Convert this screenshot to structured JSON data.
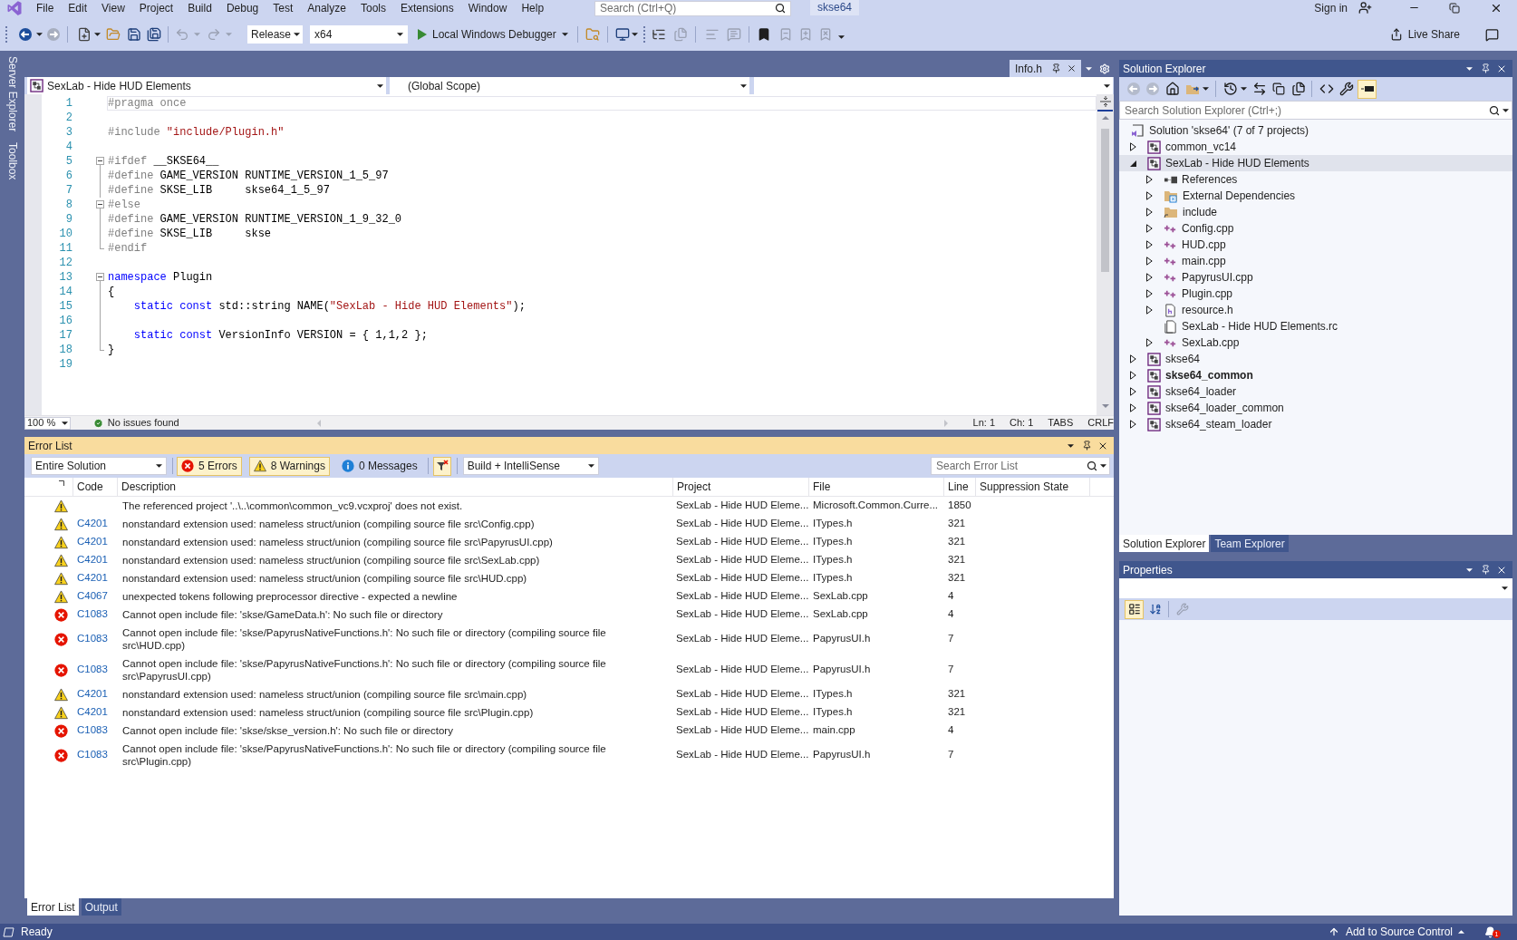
{
  "menu_bar": {
    "items": [
      "File",
      "Edit",
      "View",
      "Project",
      "Build",
      "Debug",
      "Test",
      "Analyze",
      "Tools",
      "Extensions",
      "Window",
      "Help"
    ],
    "search": {
      "placeholder": "Search (Ctrl+Q)"
    },
    "solution_name": "skse64",
    "sign_in": "Sign in"
  },
  "toolbar": {
    "configuration": "Release",
    "platform": "x64",
    "debugger": "Local Windows Debugger",
    "live_share": "Live Share"
  },
  "side_tabs": [
    "Server Explorer",
    "Toolbox"
  ],
  "editor": {
    "tab": {
      "title": "Info.h"
    },
    "navigation": {
      "project": "SexLab - Hide HUD Elements",
      "scope": "(Global Scope)"
    },
    "lines": [
      {
        "number": "1",
        "kind": "plain",
        "current": true,
        "tokens": [
          {
            "kind": "directive",
            "text": "#pragma once"
          }
        ]
      },
      {
        "number": "2",
        "kind": "plain",
        "current": false
      },
      {
        "number": "3",
        "kind": "plain",
        "current": false,
        "tokens": [
          {
            "kind": "directive",
            "text": "#include "
          },
          {
            "kind": "string",
            "text": "\"include/Plugin.h\""
          }
        ]
      },
      {
        "number": "4",
        "kind": "plain",
        "current": false
      },
      {
        "number": "5",
        "kind": "collapsible",
        "current": false,
        "tokens": [
          {
            "kind": "directive",
            "text": "#ifdef "
          },
          {
            "kind": "text",
            "text": "__SKSE64__"
          }
        ]
      },
      {
        "number": "6",
        "kind": "nested",
        "current": false,
        "tokens": [
          {
            "kind": "directive",
            "text": "#define "
          },
          {
            "kind": "text",
            "text": "GAME_VERSION RUNTIME_VERSION_1_5_97"
          }
        ]
      },
      {
        "number": "7",
        "kind": "nested",
        "current": false,
        "tokens": [
          {
            "kind": "directive",
            "text": "#define "
          },
          {
            "kind": "text",
            "text": "SKSE_LIB     skse64_1_5_97"
          }
        ]
      },
      {
        "number": "8",
        "kind": "collapsible",
        "current": false,
        "tokens": [
          {
            "kind": "directive",
            "text": "#else"
          }
        ]
      },
      {
        "number": "9",
        "kind": "nested",
        "current": false,
        "tokens": [
          {
            "kind": "directive",
            "text": "#define "
          },
          {
            "kind": "text",
            "text": "GAME_VERSION RUNTIME_VERSION_1_9_32_0"
          }
        ]
      },
      {
        "number": "10",
        "kind": "nested",
        "current": false,
        "tokens": [
          {
            "kind": "directive",
            "text": "#define "
          },
          {
            "kind": "text",
            "text": "SKSE_LIB     skse"
          }
        ]
      },
      {
        "number": "11",
        "kind": "closing",
        "current": false,
        "tokens": [
          {
            "kind": "directive",
            "text": "#endif"
          }
        ]
      },
      {
        "number": "12",
        "kind": "plain",
        "current": false
      },
      {
        "number": "13",
        "kind": "collapsible",
        "current": false,
        "tokens": [
          {
            "kind": "keyword",
            "text": "namespace "
          },
          {
            "kind": "text",
            "text": "Plugin"
          }
        ]
      },
      {
        "number": "14",
        "kind": "nested",
        "current": false,
        "tokens": [
          {
            "kind": "text",
            "text": "{"
          }
        ]
      },
      {
        "number": "15",
        "kind": "nested",
        "current": false,
        "tokens": [
          {
            "kind": "keyword",
            "text": "    static const "
          },
          {
            "kind": "text",
            "text": "std::string NAME("
          },
          {
            "kind": "string",
            "text": "\"SexLab - Hide HUD Elements\""
          },
          {
            "kind": "text",
            "text": ");"
          }
        ]
      },
      {
        "number": "16",
        "kind": "nested",
        "current": false
      },
      {
        "number": "17",
        "kind": "nested",
        "current": false,
        "tokens": [
          {
            "kind": "keyword",
            "text": "    static const "
          },
          {
            "kind": "text",
            "text": "VersionInfo VERSION = { 1,1,2 };"
          }
        ]
      },
      {
        "number": "18",
        "kind": "closing",
        "current": false,
        "tokens": [
          {
            "kind": "text",
            "text": "}"
          }
        ]
      },
      {
        "number": "19",
        "kind": "plain",
        "current": false
      }
    ],
    "status": {
      "zoom": "100 %",
      "issues": "No issues found",
      "line": "Ln: 1",
      "column": "Ch: 1",
      "indent": "TABS",
      "line_ending": "CRLF"
    }
  },
  "error_list": {
    "title": "Error List",
    "scope": "Entire Solution",
    "filters": [
      {
        "kind": "error",
        "label": "5 Errors",
        "selected": true
      },
      {
        "kind": "warning",
        "label": "8 Warnings",
        "selected": true
      },
      {
        "kind": "message",
        "label": "0 Messages",
        "selected": false
      }
    ],
    "project_filter_on": true,
    "build_filter": "Build + IntelliSense",
    "search": {
      "placeholder": "Search Error List"
    },
    "columns": [
      "Code",
      "Description",
      "Project",
      "File",
      "Line",
      "Suppression State"
    ],
    "rows": [
      {
        "kind": "warning",
        "description": "The referenced project '..\\..\\common\\common_vc9.vcxproj' does not exist.",
        "project": "SexLab - Hide HUD Eleme...",
        "file": "Microsoft.Common.Curre...",
        "line": "1850"
      },
      {
        "kind": "warning",
        "code": "C4201",
        "description": "nonstandard extension used: nameless struct/union (compiling source file src\\Config.cpp)",
        "project": "SexLab - Hide HUD Eleme...",
        "file": "ITypes.h",
        "line": "321"
      },
      {
        "kind": "warning",
        "code": "C4201",
        "description": "nonstandard extension used: nameless struct/union (compiling source file src\\PapyrusUI.cpp)",
        "project": "SexLab - Hide HUD Eleme...",
        "file": "ITypes.h",
        "line": "321"
      },
      {
        "kind": "warning",
        "code": "C4201",
        "description": "nonstandard extension used: nameless struct/union (compiling source file src\\SexLab.cpp)",
        "project": "SexLab - Hide HUD Eleme...",
        "file": "ITypes.h",
        "line": "321"
      },
      {
        "kind": "warning",
        "code": "C4201",
        "description": "nonstandard extension used: nameless struct/union (compiling source file src\\HUD.cpp)",
        "project": "SexLab - Hide HUD Eleme...",
        "file": "ITypes.h",
        "line": "321"
      },
      {
        "kind": "warning",
        "code": "C4067",
        "description": "unexpected tokens following preprocessor directive - expected a newline",
        "project": "SexLab - Hide HUD Eleme...",
        "file": "SexLab.cpp",
        "line": "4"
      },
      {
        "kind": "error",
        "code": "C1083",
        "description": "Cannot open include file: 'skse/GameData.h': No such file or directory",
        "project": "SexLab - Hide HUD Eleme...",
        "file": "SexLab.cpp",
        "line": "4"
      },
      {
        "kind": "error",
        "code": "C1083",
        "description": "Cannot open include file: 'skse/PapyrusNativeFunctions.h': No such file or directory (compiling source file src\\HUD.cpp)",
        "project": "SexLab - Hide HUD Eleme...",
        "file": "PapyrusUI.h",
        "line": "7"
      },
      {
        "kind": "error",
        "code": "C1083",
        "description": "Cannot open include file: 'skse/PapyrusNativeFunctions.h': No such file or directory (compiling source file src\\PapyrusUI.cpp)",
        "project": "SexLab - Hide HUD Eleme...",
        "file": "PapyrusUI.h",
        "line": "7"
      },
      {
        "kind": "warning",
        "code": "C4201",
        "description": "nonstandard extension used: nameless struct/union (compiling source file src\\main.cpp)",
        "project": "SexLab - Hide HUD Eleme...",
        "file": "ITypes.h",
        "line": "321"
      },
      {
        "kind": "warning",
        "code": "C4201",
        "description": "nonstandard extension used: nameless struct/union (compiling source file src\\Plugin.cpp)",
        "project": "SexLab - Hide HUD Eleme...",
        "file": "ITypes.h",
        "line": "321"
      },
      {
        "kind": "error",
        "code": "C1083",
        "description": "Cannot open include file: 'skse/skse_version.h': No such file or directory",
        "project": "SexLab - Hide HUD Eleme...",
        "file": "main.cpp",
        "line": "4"
      },
      {
        "kind": "error",
        "code": "C1083",
        "description": "Cannot open include file: 'skse/PapyrusNativeFunctions.h': No such file or directory (compiling source file src\\Plugin.cpp)",
        "project": "SexLab - Hide HUD Eleme...",
        "file": "PapyrusUI.h",
        "line": "7"
      }
    ]
  },
  "bottom_tabs": [
    {
      "label": "Error List",
      "selected": true
    },
    {
      "label": "Output",
      "selected": false
    }
  ],
  "solution_explorer": {
    "title": "Solution Explorer",
    "preview_on": true,
    "search": {
      "placeholder": "Search Solution Explorer (Ctrl+;)"
    },
    "tree": [
      {
        "kind": "solution",
        "label": "Solution 'skse64' (7 of 7 projects)",
        "selected": false,
        "children": [
          {
            "kind": "project",
            "label": "common_vc14",
            "expanded": false,
            "selected": false,
            "startup": false
          },
          {
            "kind": "project",
            "label": "SexLab - Hide HUD Elements",
            "expanded": true,
            "selected": true,
            "startup": false,
            "children": [
              {
                "kind": "references",
                "label": "References",
                "expanded": false,
                "selected": false
              },
              {
                "kind": "external",
                "label": "External Dependencies",
                "expanded": false,
                "selected": false
              },
              {
                "kind": "folder",
                "label": "include",
                "expanded": false,
                "selected": false
              },
              {
                "kind": "cpp",
                "label": "Config.cpp",
                "expanded": false,
                "selected": false
              },
              {
                "kind": "cpp",
                "label": "HUD.cpp",
                "expanded": false,
                "selected": false
              },
              {
                "kind": "cpp",
                "label": "main.cpp",
                "expanded": false,
                "selected": false
              },
              {
                "kind": "cpp",
                "label": "PapyrusUI.cpp",
                "expanded": false,
                "selected": false
              },
              {
                "kind": "cpp",
                "label": "Plugin.cpp",
                "expanded": false,
                "selected": false
              },
              {
                "kind": "header",
                "label": "resource.h",
                "expanded": false,
                "selected": false
              },
              {
                "kind": "resource",
                "label": "SexLab - Hide HUD Elements.rc",
                "selected": false
              },
              {
                "kind": "cpp",
                "label": "SexLab.cpp",
                "expanded": false,
                "selected": false
              }
            ]
          },
          {
            "kind": "project",
            "label": "skse64",
            "expanded": false,
            "selected": false,
            "startup": false
          },
          {
            "kind": "project",
            "label": "skse64_common",
            "expanded": false,
            "selected": false,
            "startup": true
          },
          {
            "kind": "project",
            "label": "skse64_loader",
            "expanded": false,
            "selected": false,
            "startup": false
          },
          {
            "kind": "project",
            "label": "skse64_loader_common",
            "expanded": false,
            "selected": false,
            "startup": false
          },
          {
            "kind": "project",
            "label": "skse64_steam_loader",
            "expanded": false,
            "selected": false,
            "startup": false
          }
        ]
      }
    ],
    "tabs": [
      {
        "label": "Solution Explorer",
        "selected": true
      },
      {
        "label": "Team Explorer",
        "selected": false
      }
    ]
  },
  "properties": {
    "title": "Properties",
    "tools": [
      {
        "kind": "categorized",
        "selected": true,
        "disabled": false
      },
      {
        "kind": "alphabetical",
        "selected": false,
        "disabled": false
      },
      {
        "kind": "pages",
        "selected": false,
        "disabled": true
      }
    ]
  },
  "status_bar": {
    "text": "Ready",
    "source_control": "Add to Source Control",
    "notifications": "1"
  }
}
